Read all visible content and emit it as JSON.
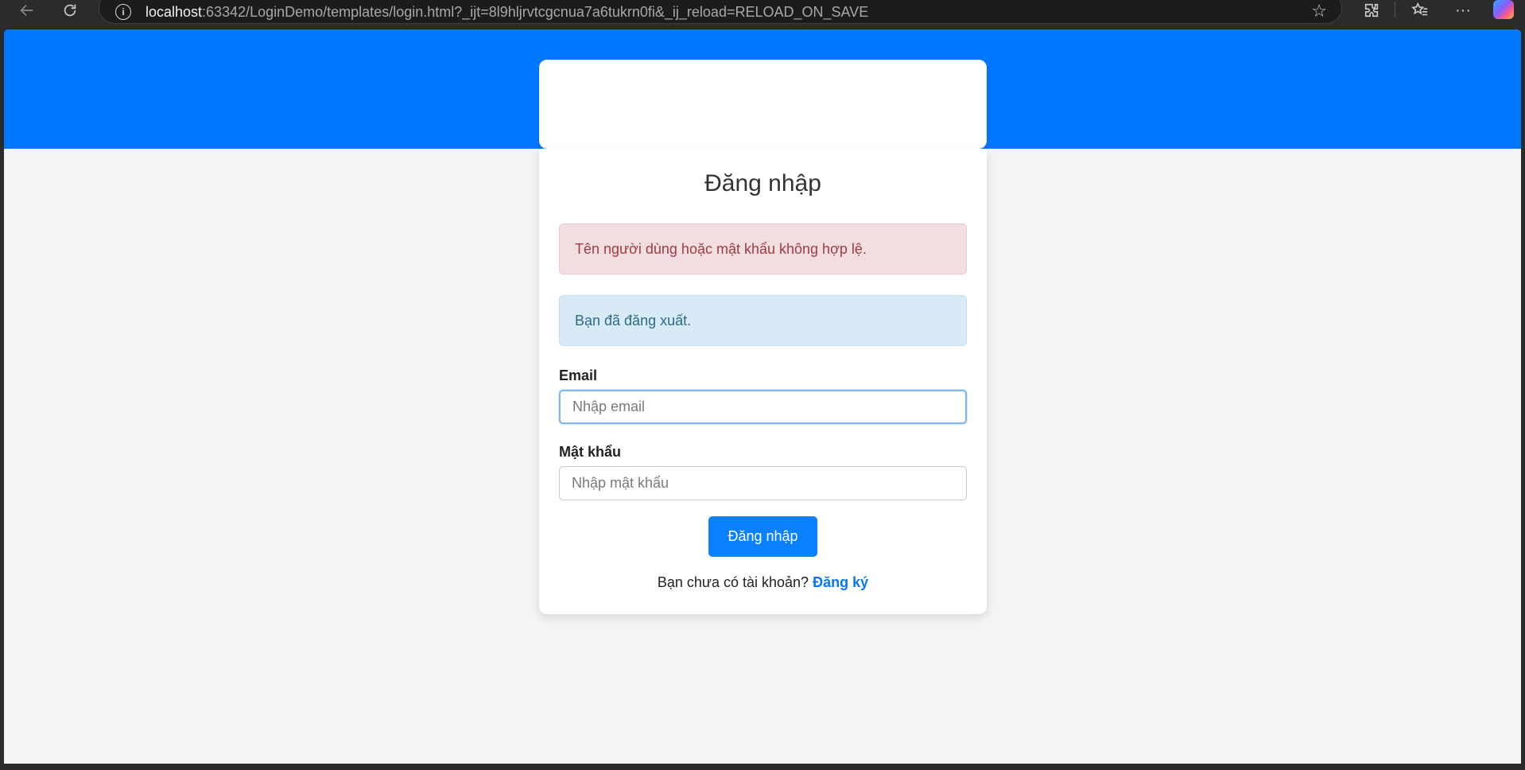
{
  "browser": {
    "url_host": "localhost",
    "url_rest": ":63342/LoginDemo/templates/login.html?_ijt=8l9hljrvtcgcnua7a6tukrn0fi&_ij_reload=RELOAD_ON_SAVE",
    "icons": [
      "back-arrow-icon",
      "reload-icon",
      "info-icon",
      "star-icon",
      "extensions-icon",
      "favorites-icon",
      "more-icon",
      "copilot-icon"
    ]
  },
  "login": {
    "title": "Đăng nhập",
    "alerts": {
      "error": "Tên người dùng hoặc mật khẩu không hợp lệ.",
      "info": "Bạn đã đăng xuất."
    },
    "email": {
      "label": "Email",
      "placeholder": "Nhập email",
      "value": ""
    },
    "password": {
      "label": "Mật khẩu",
      "placeholder": "Nhập mật khẩu",
      "value": ""
    },
    "submit_label": "Đăng nhập",
    "register": {
      "prompt": "Bạn chưa có tài khoản?",
      "link_label": "Đăng ký"
    }
  },
  "colors": {
    "hero_background": "#0077ff",
    "page_background": "#f4f4f4",
    "primary_button": "#0a80ff",
    "link": "#0a76f0",
    "alert_error_bg": "#f2dedf",
    "alert_error_text": "#9e3c43",
    "alert_info_bg": "#d8eaf5",
    "alert_info_text": "#2c6a8a"
  }
}
